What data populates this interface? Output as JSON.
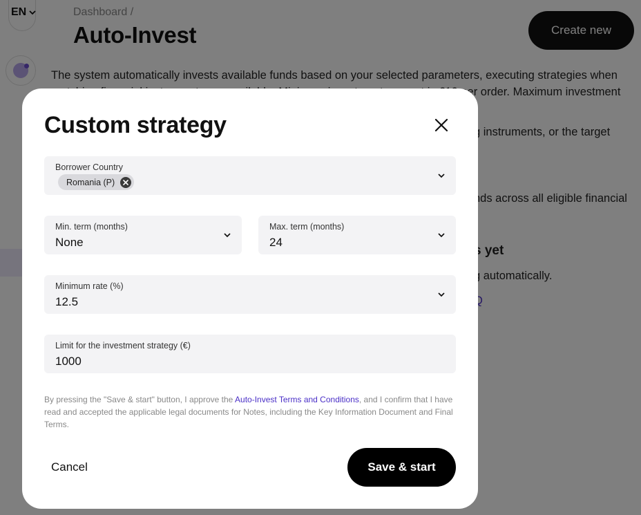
{
  "background": {
    "language": "EN",
    "breadcrumb": "Dashboard /",
    "page_title": "Auto-Invest",
    "create_button": "Create new",
    "description_line1": "The system automatically invests available funds based on your selected parameters, executing strategies when",
    "description_line2_left": "matching financial instruments are available. Minimum investment amount is €10 per order. Maximum investment",
    "fragments": {
      "instruments": "g instruments, or the target",
      "funds": "nds across all eligible financial",
      "dot": ".",
      "empty_heading": "s yet",
      "automatically": "g automatically.",
      "faq": "Q"
    }
  },
  "modal": {
    "title": "Custom strategy",
    "borrower_country": {
      "label": "Borrower Country",
      "chips": [
        "Romania (P)"
      ]
    },
    "min_term": {
      "label": "Min. term (months)",
      "value": "None"
    },
    "max_term": {
      "label": "Max. term (months)",
      "value": "24"
    },
    "min_rate": {
      "label": "Minimum rate (%)",
      "value": "12.5"
    },
    "limit": {
      "label": "Limit for the investment strategy (€)",
      "value": "1000"
    },
    "legal": {
      "before": "By pressing the \"Save & start\" button, I approve the ",
      "link": "Auto-Invest Terms and Conditions",
      "after": ", and I confirm that I have read and accepted the applicable legal documents for Notes, including the Key Information Document and Final Terms."
    },
    "cancel_button": "Cancel",
    "save_button": "Save & start"
  },
  "icons": {
    "close": "close-icon",
    "chevron": "chevron-down-icon",
    "chip_remove": "remove-chip-icon"
  },
  "colors": {
    "accent": "#4a2fc7",
    "primary_button": "#000000",
    "field_background": "#f3f3f5"
  }
}
